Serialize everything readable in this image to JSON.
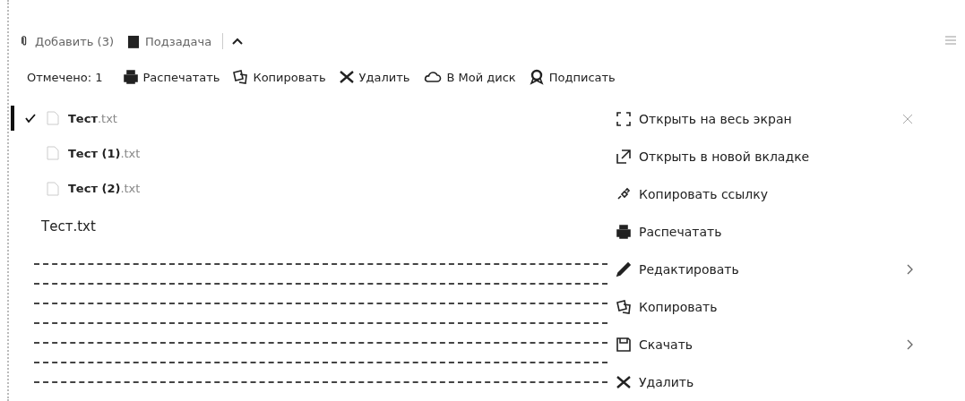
{
  "top_toolbar": {
    "items": [
      {
        "label": "Добавить (3)"
      },
      {
        "label": "Подзадача"
      }
    ]
  },
  "selection_toolbar": {
    "count_label": "Отмечено: 1",
    "actions": [
      {
        "label": "Распечатать"
      },
      {
        "label": "Копировать"
      },
      {
        "label": "Удалить"
      },
      {
        "label": "В Мой диск"
      },
      {
        "label": "Подписать"
      }
    ]
  },
  "files": [
    {
      "name": "Тест",
      "ext": ".txt",
      "selected": true
    },
    {
      "name": "Тест (1)",
      "ext": ".txt",
      "selected": false
    },
    {
      "name": "Тест (2)",
      "ext": ".txt",
      "selected": false
    }
  ],
  "preview": {
    "title": "Тест.txt"
  },
  "context_menu": {
    "items": [
      {
        "label": "Открыть на весь экран",
        "submenu": false
      },
      {
        "label": "Открыть в новой вкладке",
        "submenu": false
      },
      {
        "label": "Копировать ссылку",
        "submenu": false
      },
      {
        "label": "Распечатать",
        "submenu": false
      },
      {
        "label": "Редактировать",
        "submenu": true
      },
      {
        "label": "Копировать",
        "submenu": false
      },
      {
        "label": "Скачать",
        "submenu": true
      },
      {
        "label": "Удалить",
        "submenu": false
      }
    ]
  }
}
